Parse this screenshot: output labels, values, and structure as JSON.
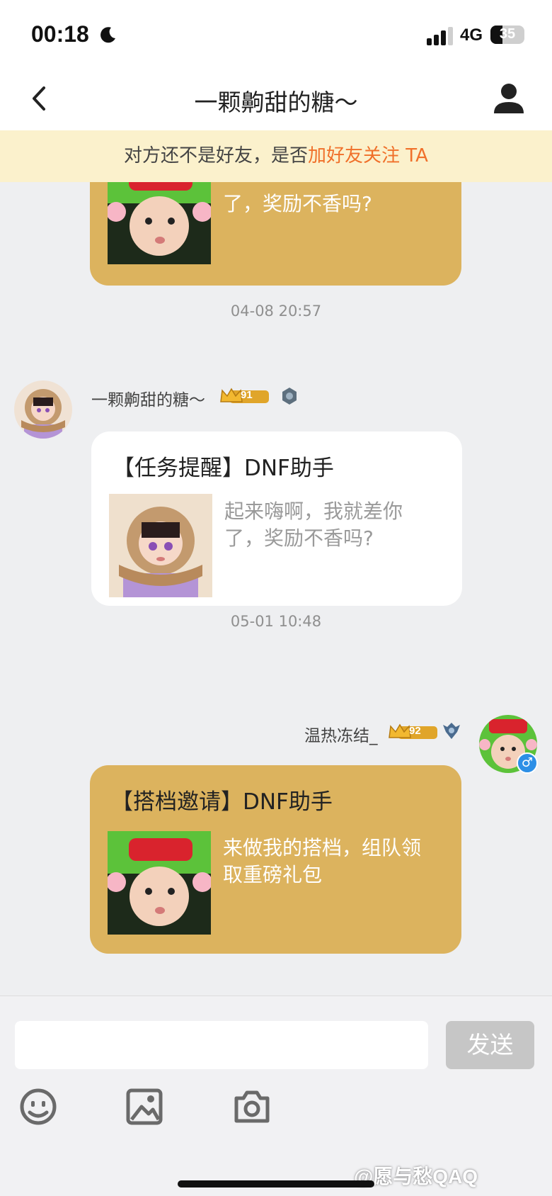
{
  "status_bar": {
    "time": "00:18",
    "network": "4G",
    "battery": "35"
  },
  "nav": {
    "title": "一颗齁甜的糖～"
  },
  "notice": {
    "text": "对方还不是好友，是否",
    "link": "加好友关注 TA"
  },
  "messages": [
    {
      "kind": "card",
      "side": "right",
      "partial": true,
      "body": "起来嗨啊，我就差你了，奖励不香吗?",
      "body_visible_line": "了，奖励不香吗?"
    },
    {
      "kind": "timestamp",
      "text": "04-08 20:57"
    },
    {
      "kind": "card",
      "side": "left",
      "sender": "一颗齁甜的糖～",
      "level": "91",
      "title": "【任务提醒】DNF助手",
      "body": "起来嗨啊，我就差你了，奖励不香吗?"
    },
    {
      "kind": "timestamp",
      "text": "05-01 10:48"
    },
    {
      "kind": "card",
      "side": "right",
      "sender": "温热冻结_",
      "level": "92",
      "title": "【搭档邀请】DNF助手",
      "body": "来做我的搭档，组队领取重磅礼包"
    }
  ],
  "input": {
    "placeholder": "",
    "send_label": "发送"
  },
  "toolbar": {
    "icons": [
      "emoji-icon",
      "image-icon",
      "camera-icon"
    ]
  },
  "watermark": "@愿与愁QAQ",
  "colors": {
    "gold_bubble": "#dcb35e",
    "notice_bg": "#fbf1cc",
    "notice_link": "#f0702a",
    "send_disabled": "#c6c6c6"
  }
}
